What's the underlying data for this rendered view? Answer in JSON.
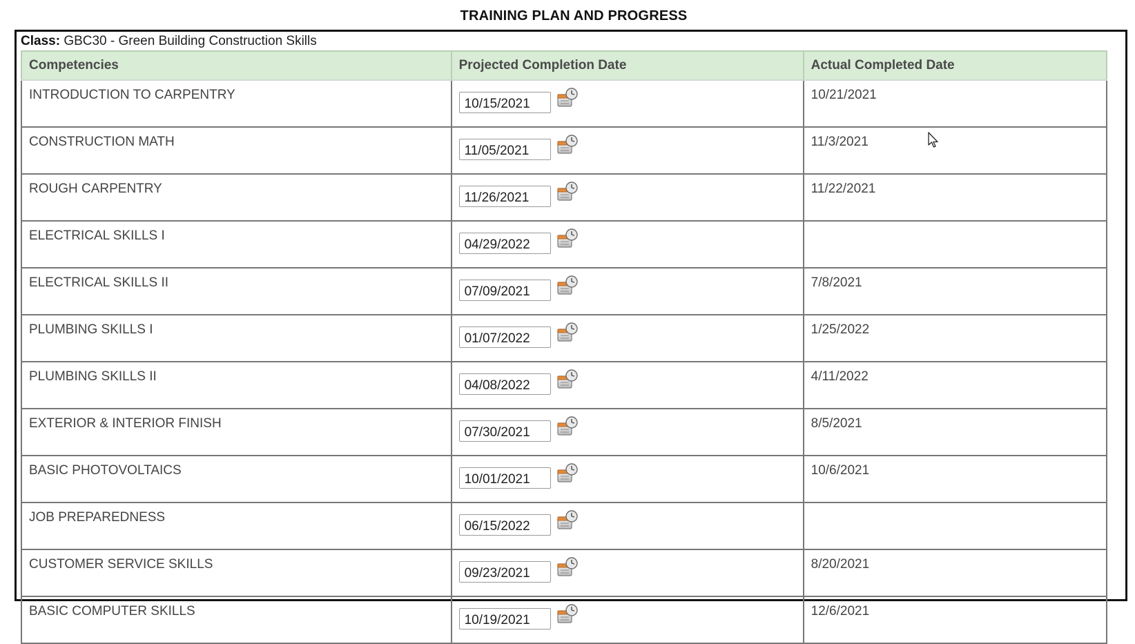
{
  "page": {
    "title": "TRAINING PLAN AND PROGRESS"
  },
  "class_info": {
    "label": "Class:",
    "value": "GBC30 - Green Building Construction Skills"
  },
  "table": {
    "headers": [
      "Competencies",
      "Projected Completion Date",
      "Actual Completed Date"
    ],
    "rows": [
      {
        "competency": "INTRODUCTION TO CARPENTRY",
        "projected": "10/15/2021",
        "actual": "10/21/2021"
      },
      {
        "competency": "CONSTRUCTION MATH",
        "projected": "11/05/2021",
        "actual": "11/3/2021"
      },
      {
        "competency": "ROUGH CARPENTRY",
        "projected": "11/26/2021",
        "actual": "11/22/2021"
      },
      {
        "competency": "ELECTRICAL SKILLS I",
        "projected": "04/29/2022",
        "actual": ""
      },
      {
        "competency": "ELECTRICAL SKILLS II",
        "projected": "07/09/2021",
        "actual": "7/8/2021"
      },
      {
        "competency": "PLUMBING SKILLS I",
        "projected": "01/07/2022",
        "actual": "1/25/2022"
      },
      {
        "competency": "PLUMBING SKILLS II",
        "projected": "04/08/2022",
        "actual": "4/11/2022"
      },
      {
        "competency": "EXTERIOR & INTERIOR FINISH",
        "projected": "07/30/2021",
        "actual": "8/5/2021"
      },
      {
        "competency": "BASIC PHOTOVOLTAICS",
        "projected": "10/01/2021",
        "actual": "10/6/2021"
      },
      {
        "competency": "JOB PREPAREDNESS",
        "projected": "06/15/2022",
        "actual": ""
      },
      {
        "competency": "CUSTOMER SERVICE SKILLS",
        "projected": "09/23/2021",
        "actual": "8/20/2021"
      },
      {
        "competency": "BASIC COMPUTER SKILLS",
        "projected": "10/19/2021",
        "actual": "12/6/2021"
      }
    ]
  },
  "icons": {
    "date_picker": "calendar-picker-icon",
    "cursor": "mouse-pointer-icon"
  },
  "colors": {
    "header_bg": "#d9ecd6",
    "border": "#777777",
    "outer_border": "#111111"
  }
}
